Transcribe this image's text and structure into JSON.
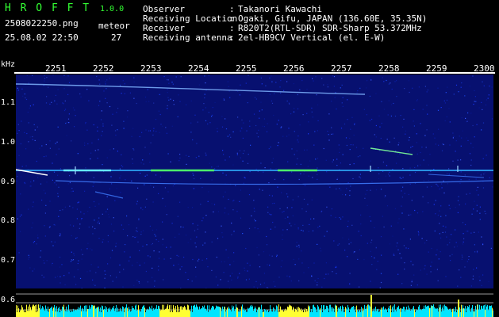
{
  "app": {
    "title": "H R O F F T",
    "version": "1.0.0",
    "filename": "2508022250.png",
    "datetime": "25.08.02 22:50",
    "meteor_label": "meteor",
    "meteor_count": "27"
  },
  "info": [
    {
      "label": "Observer",
      "value": "Takanori Kawachi"
    },
    {
      "label": "Receiving Location",
      "value": "Ogaki, Gifu, JAPAN (136.60E, 35.35N)"
    },
    {
      "label": "Receiver",
      "value": "R820T2(RTL-SDR) SDR-Sharp 53.372MHz"
    },
    {
      "label": "Receiving antenna",
      "value": "2el-HB9CV Vertical (el. E-W)"
    }
  ],
  "axis": {
    "unit": "kHz",
    "time_ticks": [
      "2251",
      "2252",
      "2253",
      "2254",
      "2255",
      "2256",
      "2257",
      "2258",
      "2259",
      "2300"
    ],
    "freq_ticks": [
      "1.1",
      "1.0",
      "0.9",
      "0.8",
      "0.7",
      "0.6"
    ]
  },
  "colors": {
    "background": "#000000",
    "noise": "#0a1a8c",
    "trace": "#7fb4ff",
    "carrier": "#4cff6a",
    "bar_cyan": "#00e5ff",
    "bar_yellow": "#ffff33",
    "text_green": "#33ff33"
  }
}
